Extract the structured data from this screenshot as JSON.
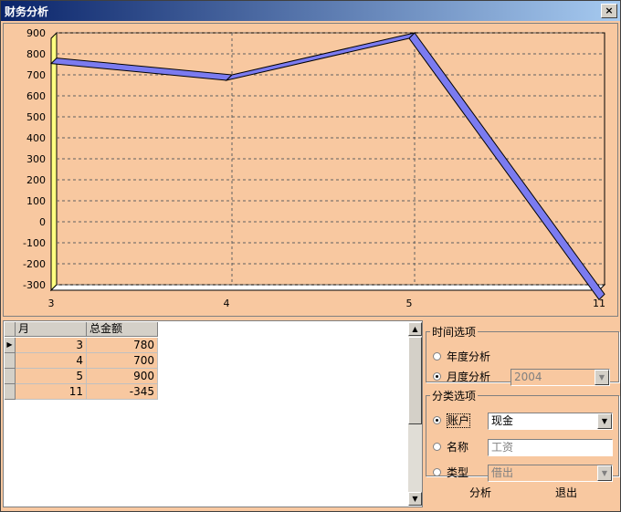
{
  "window": {
    "title": "财务分析",
    "close_glyph": "×"
  },
  "chart_data": {
    "type": "line",
    "categories": [
      "3",
      "4",
      "5",
      "11"
    ],
    "values": [
      780,
      700,
      900,
      -345
    ],
    "ylim": [
      -345,
      900
    ],
    "yticks": [
      "900",
      "800",
      "700",
      "600",
      "500",
      "400",
      "300",
      "200",
      "100",
      "0",
      "-100",
      "-200",
      "-300"
    ],
    "grid": true,
    "series_color": "#7b7bf0"
  },
  "table": {
    "columns": [
      "月",
      "总金额"
    ],
    "rows": [
      [
        "3",
        "780"
      ],
      [
        "4",
        "700"
      ],
      [
        "5",
        "900"
      ],
      [
        "11",
        "-345"
      ]
    ],
    "current_row_marker": "▶"
  },
  "time_options": {
    "legend": "时间选项",
    "yearly_label": "年度分析",
    "monthly_label": "月度分析",
    "selected": "monthly",
    "year_value": "2004"
  },
  "category_options": {
    "legend": "分类选项",
    "account_label": "账户",
    "account_value": "现金",
    "name_label": "名称",
    "name_value": "工资",
    "type_label": "类型",
    "type_value": "借出",
    "selected": "account"
  },
  "buttons": {
    "analyze": "分析",
    "exit": "退出"
  },
  "icons": {
    "dropdown": "▼",
    "scroll_up": "▲",
    "scroll_down": "▼"
  }
}
